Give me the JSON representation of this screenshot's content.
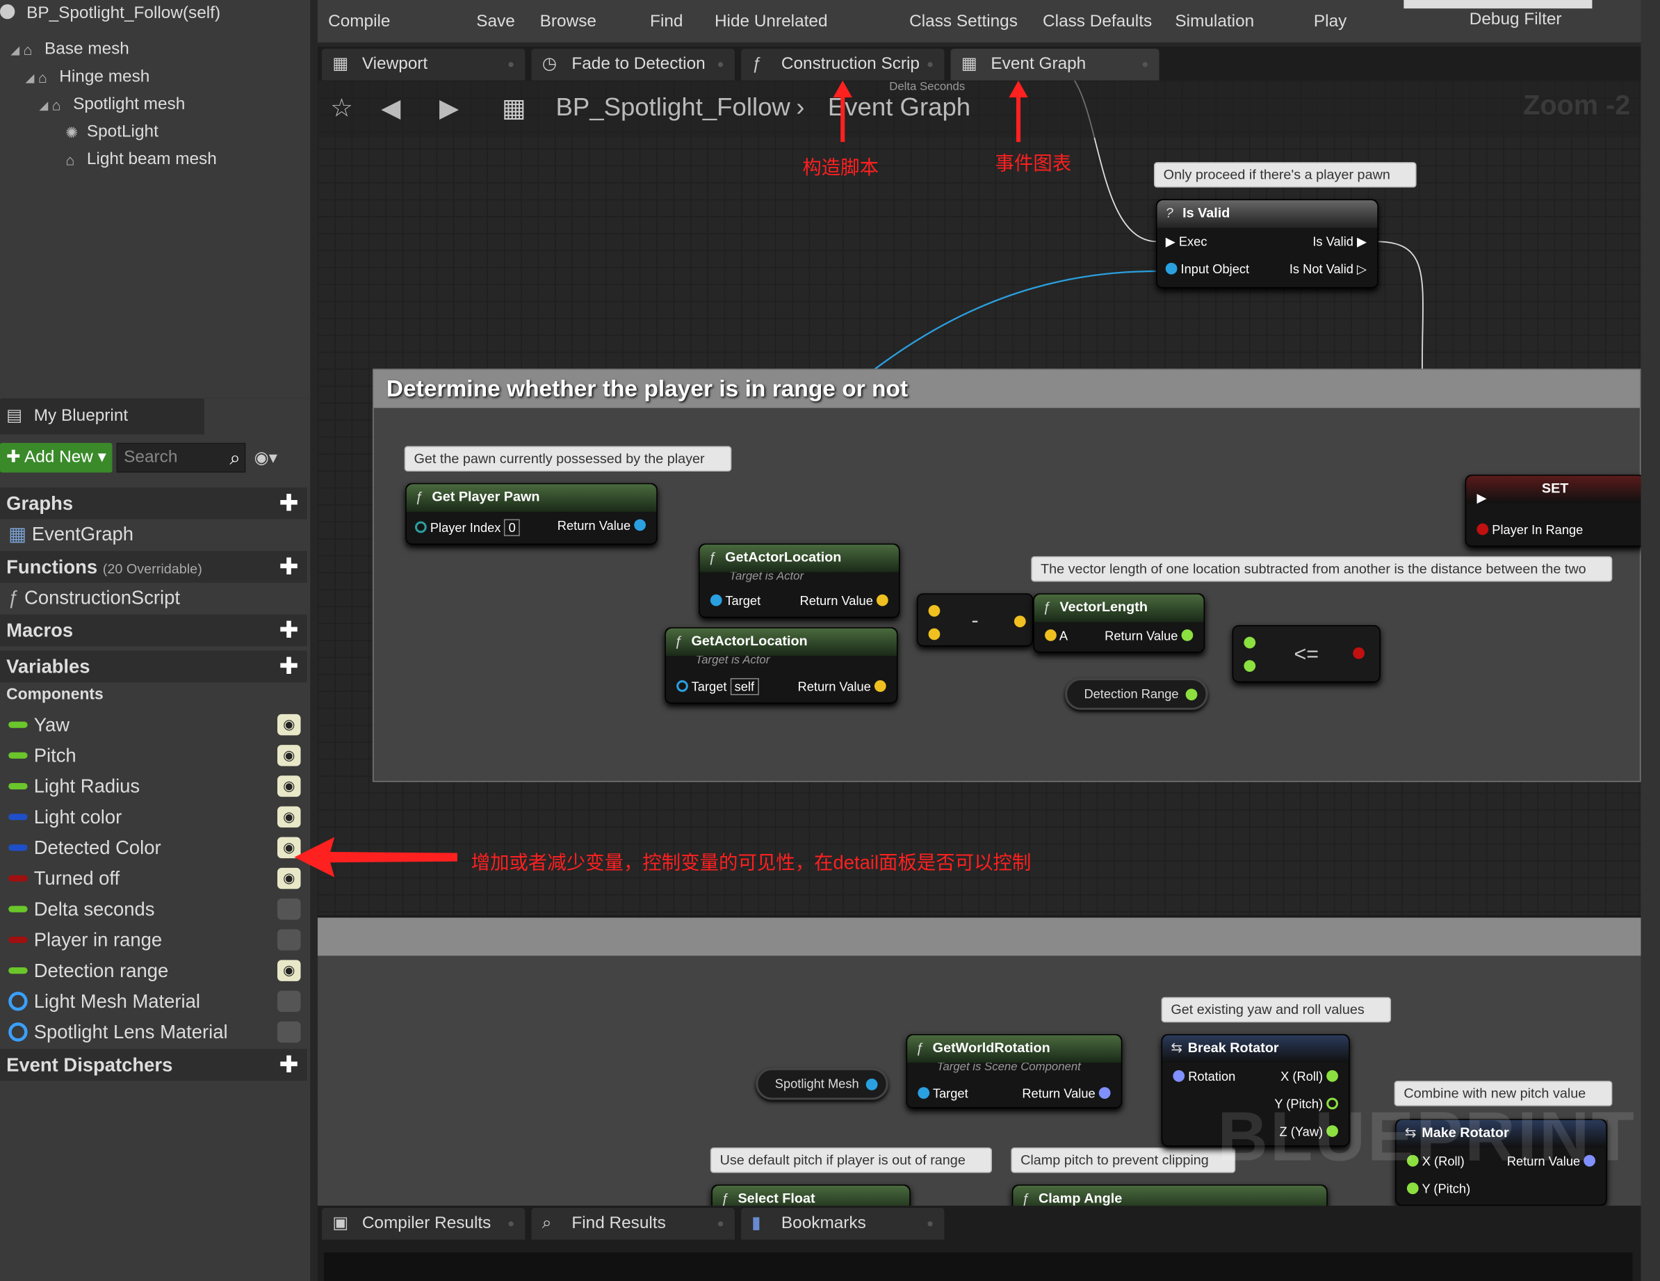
{
  "components": {
    "title": "BP_Spotlight_Follow(self)",
    "items": [
      {
        "label": "Base mesh"
      },
      {
        "label": "Hinge mesh"
      },
      {
        "label": "Spotlight mesh"
      },
      {
        "label": "SpotLight"
      },
      {
        "label": "Light beam mesh"
      }
    ]
  },
  "my_blueprint": {
    "tab": "My Blueprint",
    "add_new": "Add New",
    "search_placeholder": "Search",
    "graphs": "Graphs",
    "eventgraph": "EventGraph",
    "functions": "Functions",
    "overridable": "(20 Overridable)",
    "construction": "ConstructionScript",
    "macros": "Macros",
    "variables": "Variables",
    "components": "Components",
    "event_dispatchers": "Event Dispatchers",
    "vars": [
      {
        "name": "Yaw",
        "color": "#6ac62a",
        "visible": true
      },
      {
        "name": "Pitch",
        "color": "#6ac62a",
        "visible": true
      },
      {
        "name": "Light Radius",
        "color": "#6ac62a",
        "visible": true
      },
      {
        "name": "Light color",
        "color": "#1f4fc8",
        "visible": true
      },
      {
        "name": "Detected Color",
        "color": "#1f4fc8",
        "visible": true
      },
      {
        "name": "Turned off",
        "color": "#a01010",
        "visible": true
      },
      {
        "name": "Delta seconds",
        "color": "#6ac62a",
        "visible": false
      },
      {
        "name": "Player in range",
        "color": "#a01010",
        "visible": false
      },
      {
        "name": "Detection range",
        "color": "#6ac62a",
        "visible": true
      },
      {
        "name": "Light Mesh Material",
        "color": "#3aa0ff",
        "visible": false,
        "ring": true
      },
      {
        "name": "Spotlight Lens Material",
        "color": "#3aa0ff",
        "visible": false,
        "ring": true
      }
    ]
  },
  "toolbar": {
    "compile": "Compile",
    "save": "Save",
    "browse": "Browse",
    "find": "Find",
    "hide_unrelated": "Hide Unrelated",
    "class_settings": "Class Settings",
    "class_defaults": "Class Defaults",
    "simulation": "Simulation",
    "play": "Play",
    "debug_filter": "Debug Filter"
  },
  "tabs": {
    "viewport": "Viewport",
    "fade": "Fade to Detection",
    "construction": "Construction Scrip",
    "event_graph": "Event Graph",
    "delta": "Delta Seconds"
  },
  "breadcrumb": {
    "bp": "BP_Spotlight_Follow",
    "graph": "Event Graph",
    "zoom": "Zoom -2"
  },
  "annotations": {
    "construction_cn": "构造脚本",
    "eventgraph_cn": "事件图表",
    "vars_cn": "增加或者减少变量，控制变量的可见性，在detail面板是否可以控制"
  },
  "graph": {
    "comment1": "Determine whether the player is in range or not",
    "b_player_pawn": "Only proceed if there's a player pawn",
    "b_get_pawn": "Get the pawn currently possessed by the player",
    "b_vector": "The vector length of one location subtracted from another is the distance between the two",
    "b_yaw_roll": "Get existing yaw and roll values",
    "b_combine": "Combine with new pitch value",
    "b_default_pitch": "Use default pitch if player is out of range",
    "b_clamp": "Clamp pitch to prevent clipping",
    "isvalid": {
      "title": "Is Valid",
      "exec": "Exec",
      "isvalid": "Is Valid",
      "input": "Input Object",
      "notvalid": "Is Not Valid"
    },
    "getpawn": {
      "title": "Get Player Pawn",
      "index_label": "Player Index",
      "index_val": "0",
      "ret": "Return Value"
    },
    "getloc1": {
      "title": "GetActorLocation",
      "sub": "Target is Actor",
      "target": "Target",
      "ret": "Return Value"
    },
    "getloc2": {
      "title": "GetActorLocation",
      "sub": "Target is Actor",
      "target": "Target",
      "self": "self",
      "ret": "Return Value"
    },
    "minus": "-",
    "veclen": {
      "title": "VectorLength",
      "a": "A",
      "ret": "Return Value"
    },
    "lte": "<=",
    "detrange": "Detection Range",
    "set": {
      "title": "SET",
      "pin": "Player In Range"
    },
    "getworldrot": {
      "title": "GetWorldRotation",
      "sub": "Target is Scene Component",
      "target": "Target",
      "ret": "Return Value"
    },
    "spotmesh": "Spotlight Mesh",
    "breakrot": {
      "title": "Break Rotator",
      "rot": "Rotation",
      "x": "X (Roll)",
      "y": "Y (Pitch)",
      "z": "Z (Yaw)"
    },
    "makerot": {
      "title": "Make Rotator",
      "x": "X (Roll)",
      "y": "Y (Pitch)",
      "ret": "Return Value"
    },
    "selectfloat": "Select Float",
    "clamp": "Clamp Angle",
    "watermark": "BLUEPRINT"
  },
  "bottom": {
    "compiler": "Compiler Results",
    "find": "Find Results",
    "bookmarks": "Bookmarks"
  }
}
